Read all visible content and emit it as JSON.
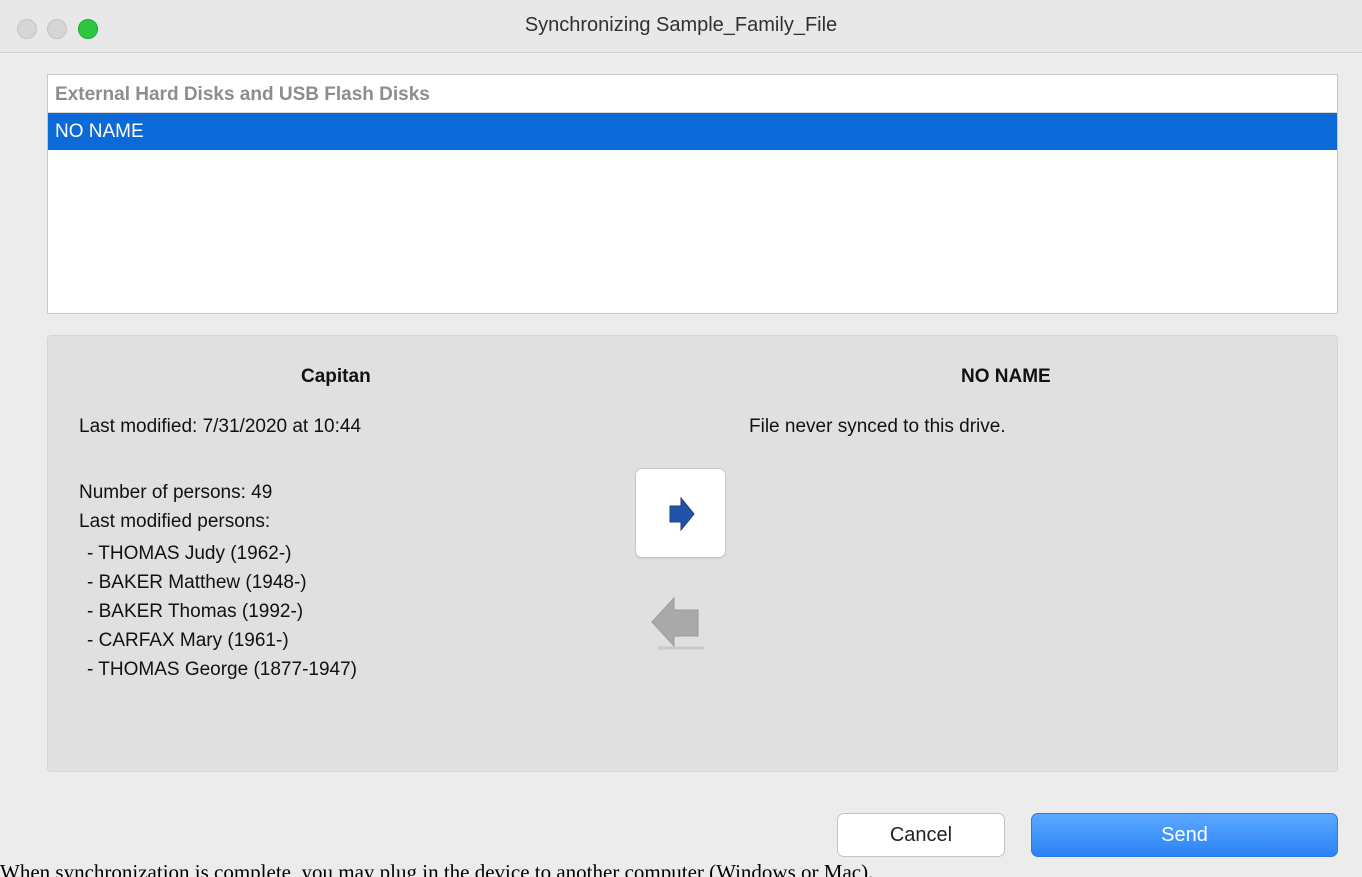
{
  "window": {
    "title": "Synchronizing Sample_Family_File"
  },
  "drives": {
    "header": "External Hard Disks and USB Flash Disks",
    "items": [
      {
        "label": "NO NAME",
        "selected": true
      }
    ]
  },
  "source": {
    "title": "Capitan",
    "last_modified": "Last modified: 7/31/2020 at 10:44",
    "persons_count": "Number of persons: 49",
    "last_modified_persons_label": "Last modified persons:",
    "persons": [
      "- THOMAS Judy (1962-)",
      "- BAKER Matthew (1948-)",
      "- BAKER Thomas (1992-)",
      "- CARFAX Mary (1961-)",
      "- THOMAS George (1877-1947)"
    ]
  },
  "target": {
    "title": "NO NAME",
    "status": "File never synced to this drive."
  },
  "direction": {
    "to_drive_icon": "arrow-right-icon",
    "to_computer_icon": "arrow-left-icon",
    "selected": "to_drive"
  },
  "buttons": {
    "cancel": "Cancel",
    "send": "Send"
  },
  "caption": "When synchronization is complete, you may plug in the device to another computer (Windows or Mac).",
  "colors": {
    "selection": "#0b69d8",
    "send_button": "#2b84f5",
    "arrow_active": "#2353a8",
    "arrow_inactive": "#a9a9a9",
    "traffic_green": "#2bc840"
  }
}
